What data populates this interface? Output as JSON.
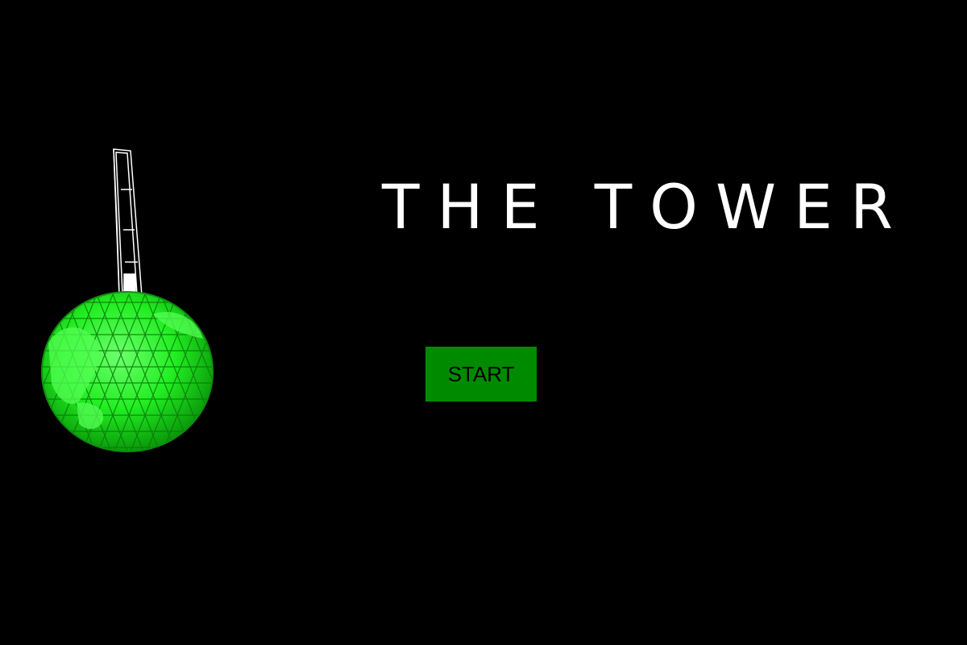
{
  "game": {
    "title": "THE TOWER",
    "start_label": "START"
  },
  "colors": {
    "background": "#000000",
    "title_text": "#ffffff",
    "button_fill": "#008a00",
    "button_text": "#000000",
    "globe_green": "#22ee22",
    "spire_outline": "#ffffff"
  },
  "icons": {
    "tower_art": "tower-globe-icon"
  }
}
